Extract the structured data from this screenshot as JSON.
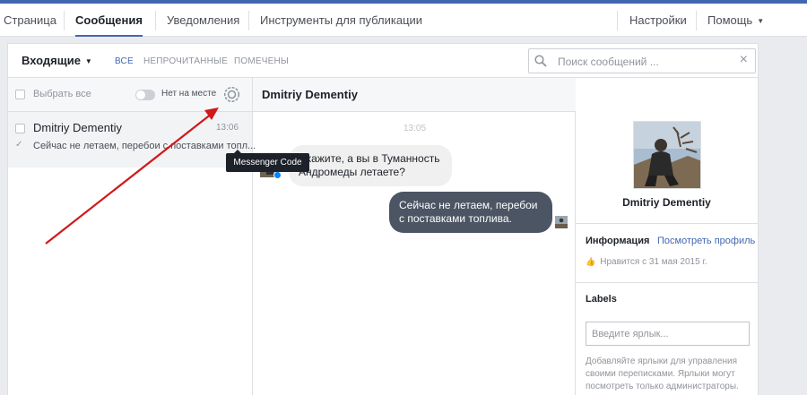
{
  "nav": {
    "items": [
      "Страница",
      "Сообщения",
      "Уведомления",
      "Инструменты для публикации"
    ],
    "settings": "Настройки",
    "help": "Помощь"
  },
  "inbox": {
    "folder": "Входящие",
    "tabs": [
      "ВСЕ",
      "НЕПРОЧИТАННЫЕ",
      "ПОМЕЧЕНЫ"
    ],
    "search_placeholder": "Поиск сообщений ..."
  },
  "list": {
    "select_all": "Выбрать все",
    "away_label": "Нет на месте",
    "tooltip": "Messenger Code",
    "conversation": {
      "name": "Dmitriy Dementiy",
      "time": "13:06",
      "snippet": "Сейчас не летаем, перебои с поставками топл..."
    }
  },
  "thread": {
    "title": "Dmitriy Dementiy",
    "timestamp": "13:05",
    "messages": [
      {
        "dir": "in",
        "text": "Скажите, а вы в Туманность Андромеды летаете?"
      },
      {
        "dir": "out",
        "text": "Сейчас не летаем, перебои с поставками топлива."
      }
    ]
  },
  "profile": {
    "name": "Dmitriy Dementiy",
    "info_label": "Информация",
    "view_profile": "Посмотреть профиль",
    "liked": "Нравится с 31 мая 2015 г.",
    "labels_heading": "Labels",
    "labels_placeholder": "Введите ярлык...",
    "labels_help": "Добавляйте ярлыки для управления своими переписками. Ярлыки могут посмотреть только администраторы."
  },
  "colors": {
    "brand": "#4267b2",
    "outgoing_bubble": "#4c5563",
    "incoming_bubble": "#f1f0f0",
    "annotation_arrow": "#d0191b"
  }
}
